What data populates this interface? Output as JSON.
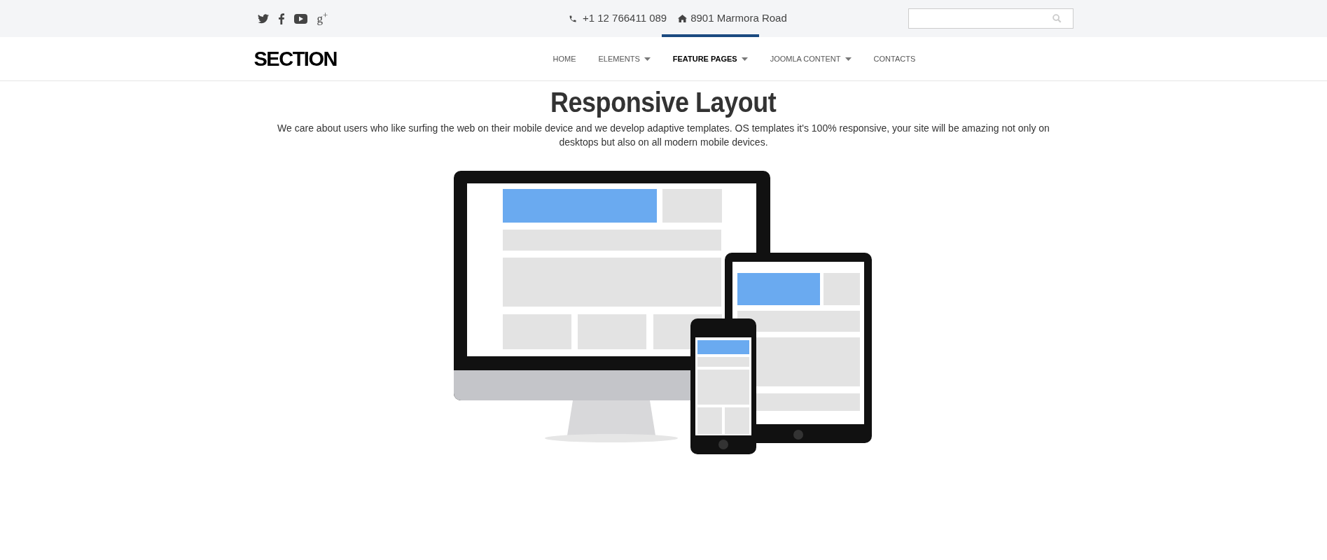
{
  "top_bar": {
    "phone": "+1 12 766411 089",
    "address": "8901 Marmora Road",
    "social_glyph": "g$^{+}$"
  },
  "logo": "SECTION",
  "nav": [
    {
      "label": "HOME",
      "selected": false,
      "dropdown": false
    },
    {
      "label": "ELEMENTS",
      "selected": false,
      "dropdown": true
    },
    {
      "label": "FEATURE PAGES",
      "selected": true,
      "dropdown": true
    },
    {
      "label": "JOOMLA CONTENT",
      "selected": false,
      "dropdown": true
    },
    {
      "label": "CONTACTS",
      "selected": false,
      "dropdown": false
    }
  ],
  "heading": "Responsive Layout",
  "text": "We care about users who like surfing the web on their mobile device and we develop adaptive templates. OS templates it's 100% responsive, your site will be amazing not only on desktops but also on all modern mobile devices."
}
